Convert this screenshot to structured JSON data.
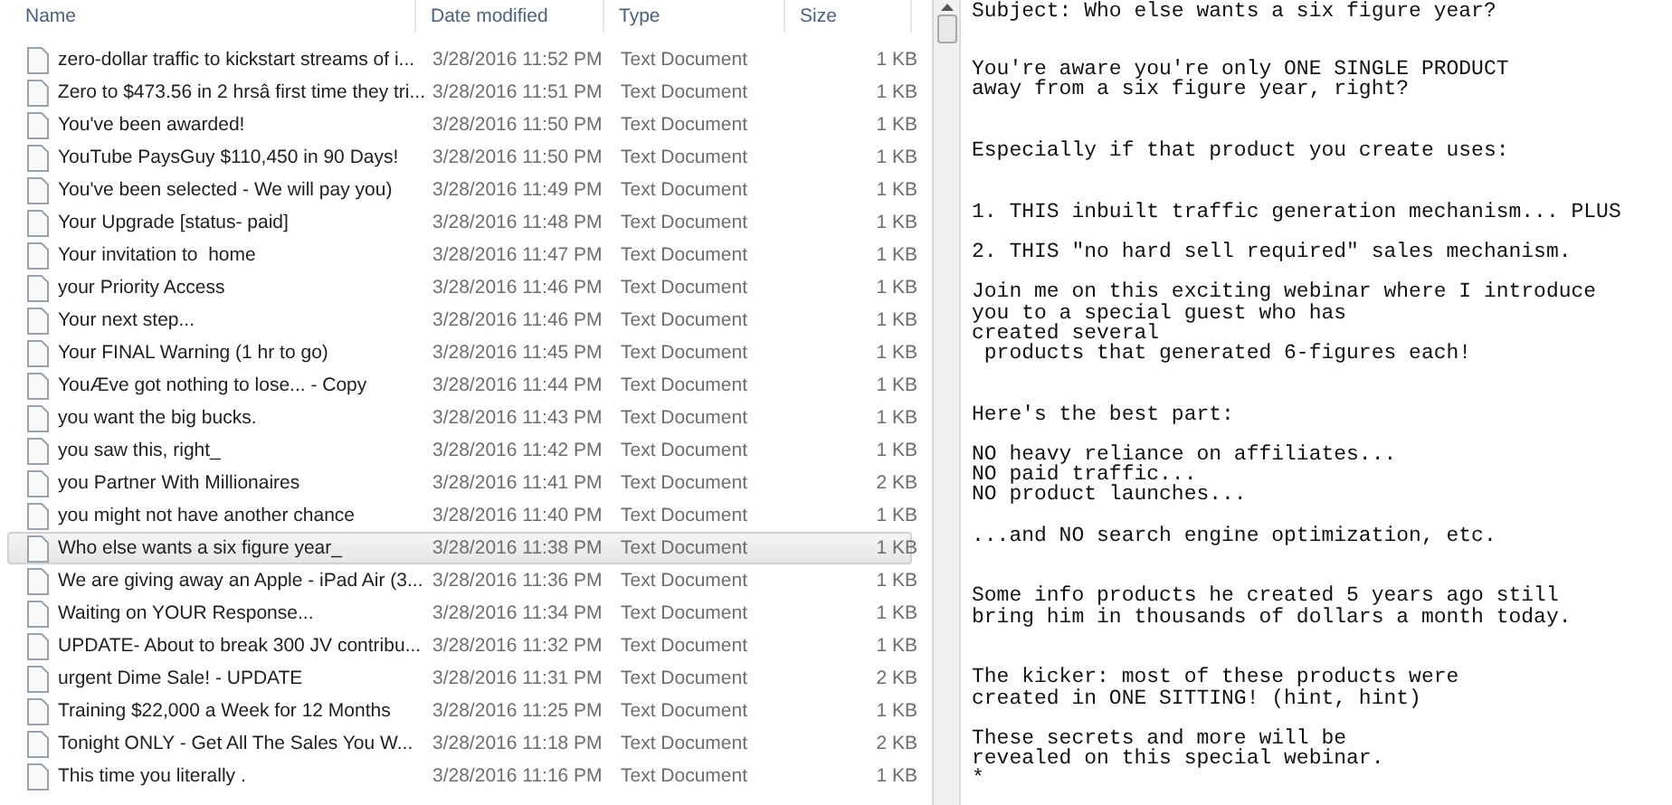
{
  "file_list": {
    "columns": [
      {
        "label": "Name"
      },
      {
        "label": "Date modified"
      },
      {
        "label": "Type"
      },
      {
        "label": "Size"
      }
    ],
    "rows": [
      {
        "name": "zero-dollar traffic to kickstart streams of i...",
        "date": "3/28/2016 11:52 PM",
        "type": "Text Document",
        "size": "1 KB",
        "selected": false
      },
      {
        "name": "Zero to $473.56 in 2 hrsâ first time they tri...",
        "date": "3/28/2016 11:51 PM",
        "type": "Text Document",
        "size": "1 KB",
        "selected": false
      },
      {
        "name": "You've been awarded!",
        "date": "3/28/2016 11:50 PM",
        "type": "Text Document",
        "size": "1 KB",
        "selected": false
      },
      {
        "name": "YouTube PaysGuy $110,450 in 90 Days!",
        "date": "3/28/2016 11:50 PM",
        "type": "Text Document",
        "size": "1 KB",
        "selected": false
      },
      {
        "name": "You've been selected - We will pay you)",
        "date": "3/28/2016 11:49 PM",
        "type": "Text Document",
        "size": "1 KB",
        "selected": false
      },
      {
        "name": "Your Upgrade [status- paid]",
        "date": "3/28/2016 11:48 PM",
        "type": "Text Document",
        "size": "1 KB",
        "selected": false
      },
      {
        "name": "Your invitation to  home",
        "date": "3/28/2016 11:47 PM",
        "type": "Text Document",
        "size": "1 KB",
        "selected": false
      },
      {
        "name": "your Priority Access",
        "date": "3/28/2016 11:46 PM",
        "type": "Text Document",
        "size": "1 KB",
        "selected": false
      },
      {
        "name": "Your next step...",
        "date": "3/28/2016 11:46 PM",
        "type": "Text Document",
        "size": "1 KB",
        "selected": false
      },
      {
        "name": "Your FINAL Warning (1 hr to go)",
        "date": "3/28/2016 11:45 PM",
        "type": "Text Document",
        "size": "1 KB",
        "selected": false
      },
      {
        "name": "YouÆve got nothing to lose... - Copy",
        "date": "3/28/2016 11:44 PM",
        "type": "Text Document",
        "size": "1 KB",
        "selected": false
      },
      {
        "name": "you want the big bucks.",
        "date": "3/28/2016 11:43 PM",
        "type": "Text Document",
        "size": "1 KB",
        "selected": false
      },
      {
        "name": "you saw this, right_",
        "date": "3/28/2016 11:42 PM",
        "type": "Text Document",
        "size": "1 KB",
        "selected": false
      },
      {
        "name": "you Partner With Millionaires",
        "date": "3/28/2016 11:41 PM",
        "type": "Text Document",
        "size": "2 KB",
        "selected": false
      },
      {
        "name": "you might not have another chance",
        "date": "3/28/2016 11:40 PM",
        "type": "Text Document",
        "size": "1 KB",
        "selected": false
      },
      {
        "name": "Who else wants a six figure year_",
        "date": "3/28/2016 11:38 PM",
        "type": "Text Document",
        "size": "1 KB",
        "selected": true
      },
      {
        "name": "We are giving away an Apple - iPad Air (3...",
        "date": "3/28/2016 11:36 PM",
        "type": "Text Document",
        "size": "1 KB",
        "selected": false
      },
      {
        "name": "Waiting on YOUR Response...",
        "date": "3/28/2016 11:34 PM",
        "type": "Text Document",
        "size": "1 KB",
        "selected": false
      },
      {
        "name": "UPDATE- About to break 300 JV contribu...",
        "date": "3/28/2016 11:32 PM",
        "type": "Text Document",
        "size": "1 KB",
        "selected": false
      },
      {
        "name": "urgent Dime Sale! - UPDATE",
        "date": "3/28/2016 11:31 PM",
        "type": "Text Document",
        "size": "2 KB",
        "selected": false
      },
      {
        "name": "Training $22,000 a Week for 12 Months",
        "date": "3/28/2016 11:25 PM",
        "type": "Text Document",
        "size": "1 KB",
        "selected": false
      },
      {
        "name": "Tonight ONLY - Get All The Sales You W...",
        "date": "3/28/2016 11:18 PM",
        "type": "Text Document",
        "size": "2 KB",
        "selected": false
      },
      {
        "name": "This time you literally .",
        "date": "3/28/2016 11:16 PM",
        "type": "Text Document",
        "size": "1 KB",
        "selected": false
      }
    ]
  },
  "preview": {
    "subject": "Subject: Who else wants a six figure year?",
    "body": "You're aware you're only ONE SINGLE PRODUCT\naway from a six figure year, right?\n\n\nEspecially if that product you create uses:\n\n\n1. THIS inbuilt traffic generation mechanism... PLUS\n\n2. THIS \"no hard sell required\" sales mechanism.\n\nJoin me on this exciting webinar where I introduce\nyou to a special guest who has\ncreated several\n products that generated 6-figures each!\n\n\nHere's the best part:\n\nNO heavy reliance on affiliates...\nNO paid traffic...\nNO product launches...\n\n...and NO search engine optimization, etc.\n\n\nSome info products he created 5 years ago still\nbring him in thousands of dollars a month today.\n\n\nThe kicker: most of these products were\ncreated in ONE SITTING! (hint, hint)\n\nThese secrets and more will be\nrevealed on this special webinar.\n*"
  }
}
